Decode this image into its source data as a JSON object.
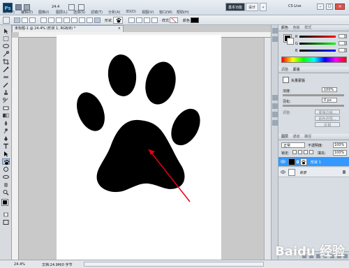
{
  "app": {
    "name": "Ps",
    "zoom": "24.4"
  },
  "menus": [
    "文件(F)",
    "编辑(E)",
    "图像(I)",
    "图层(L)",
    "选择(S)",
    "滤镜(T)",
    "分析(A)",
    "3D(D)",
    "视图(V)",
    "窗口(W)",
    "帮助(H)"
  ],
  "workspace": {
    "basic": "基本功能",
    "design": "设计",
    "more": "»",
    "cslive": "CS Live"
  },
  "options": {
    "shape_label": "形状",
    "style_label": "样式",
    "color_label": "颜色"
  },
  "document": {
    "tab_title": "未标题-1 @ 24.4% (形状 1, RGB/8) *",
    "status_zoom": "24.4%",
    "status_doc": "文档:24.9M/0 字节"
  },
  "color_panel": {
    "tabs": [
      "颜色",
      "色板",
      "样式"
    ],
    "channels": [
      "R",
      "G",
      "B"
    ],
    "values": [
      "0",
      "0",
      "0"
    ]
  },
  "adjust_panel": {
    "tabs": [
      "调整",
      "蒙版"
    ],
    "mask_label": "矢量蒙版",
    "density_label": "浓度:",
    "density_value": "100%",
    "feather_label": "羽化:",
    "feather_value": "0 px",
    "refine_label": "调整:",
    "btn1": "蒙版边缘...",
    "btn2": "颜色范围...",
    "btn3": "反相"
  },
  "layers_panel": {
    "tabs": [
      "图层",
      "通道",
      "路径"
    ],
    "blend_mode": "正常",
    "opacity_label": "不透明度:",
    "opacity_value": "100%",
    "lock_label": "锁定:",
    "fill_label": "填充:",
    "fill_value": "100%",
    "layers": [
      {
        "name": "形状 1",
        "selected": true
      },
      {
        "name": "背景",
        "selected": false
      }
    ]
  },
  "watermark": "Baidu 经验",
  "colors": {
    "accent": "#3399ff",
    "arrow": "#e60012"
  }
}
